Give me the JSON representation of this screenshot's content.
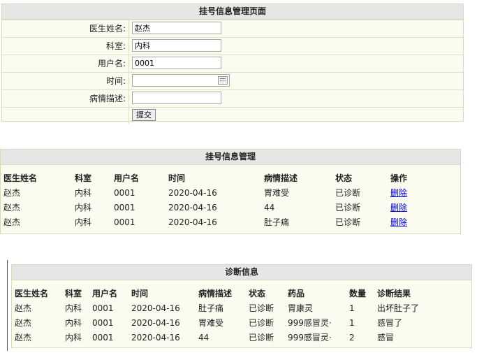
{
  "form": {
    "title": "挂号信息管理页面",
    "fields": {
      "doctor": {
        "label": "医生姓名:",
        "value": "赵杰"
      },
      "dept": {
        "label": "科室:",
        "value": "内科"
      },
      "username": {
        "label": "用户名:",
        "value": "0001"
      },
      "time": {
        "label": "时间:",
        "value": ""
      },
      "condition": {
        "label": "病情描述:",
        "value": ""
      }
    },
    "submit_label": "提交"
  },
  "registration": {
    "title": "挂号信息管理",
    "headers": [
      "医生姓名",
      "科室",
      "用户名",
      "时间",
      "病情描述",
      "状态",
      "操作"
    ],
    "rows": [
      {
        "doctor": "赵杰",
        "dept": "内科",
        "user": "0001",
        "time": "2020-04-16",
        "desc": "胃难受",
        "status": "已诊断",
        "action": "删除"
      },
      {
        "doctor": "赵杰",
        "dept": "内科",
        "user": "0001",
        "time": "2020-04-16",
        "desc": "44",
        "status": "已诊断",
        "action": "删除"
      },
      {
        "doctor": "赵杰",
        "dept": "内科",
        "user": "0001",
        "time": "2020-04-16",
        "desc": "肚子痛",
        "status": "已诊断",
        "action": "删除"
      }
    ]
  },
  "diagnosis": {
    "title": "诊断信息",
    "headers": [
      "医生姓名",
      "科室",
      "用户名",
      "时间",
      "病情描述",
      "状态",
      "药品",
      "数量",
      "诊断结果"
    ],
    "rows": [
      {
        "doctor": "赵杰",
        "dept": "内科",
        "user": "0001",
        "time": "2020-04-16",
        "desc": "肚子痛",
        "status": "已诊断",
        "drug": "胃康灵",
        "qty": "1",
        "result": "出坏肚子了"
      },
      {
        "doctor": "赵杰",
        "dept": "内科",
        "user": "0001",
        "time": "2020-04-16",
        "desc": "胃难受",
        "status": "已诊断",
        "drug": "999感冒灵·",
        "qty": "1",
        "result": "感冒了"
      },
      {
        "doctor": "赵杰",
        "dept": "内科",
        "user": "0001",
        "time": "2020-04-16",
        "desc": "44",
        "status": "已诊断",
        "drug": "999感冒灵·",
        "qty": "2",
        "result": "感冒"
      }
    ]
  },
  "colors": {
    "panel_bg": "#fbfbef",
    "title_bg": "#e6e6e6",
    "link": "#0000cc"
  }
}
